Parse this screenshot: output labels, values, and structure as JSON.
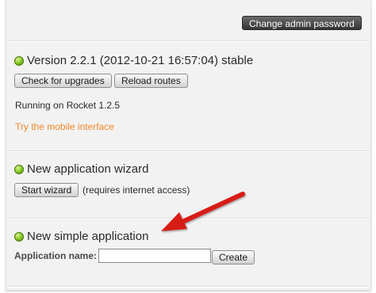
{
  "header": {
    "change_password_label": "Change admin password"
  },
  "version": {
    "heading": "Version 2.2.1 (2012-10-21 16:57:04) stable",
    "check_upgrades_label": "Check for upgrades",
    "reload_routes_label": "Reload routes",
    "running_text": "Running on Rocket 1.2.5",
    "mobile_link": "Try the mobile interface"
  },
  "wizard": {
    "heading": "New application wizard",
    "start_label": "Start wizard",
    "note": "(requires internet access)"
  },
  "simple_app": {
    "heading": "New simple application",
    "name_label": "Application name:",
    "name_value": "",
    "create_label": "Create"
  },
  "colors": {
    "status_dot": "#8fcf2a",
    "link": "#f0882a",
    "annotation_arrow": "#d81e16"
  },
  "icons": {
    "status": "green-status-dot-icon",
    "annotation": "red-arrow-icon"
  }
}
